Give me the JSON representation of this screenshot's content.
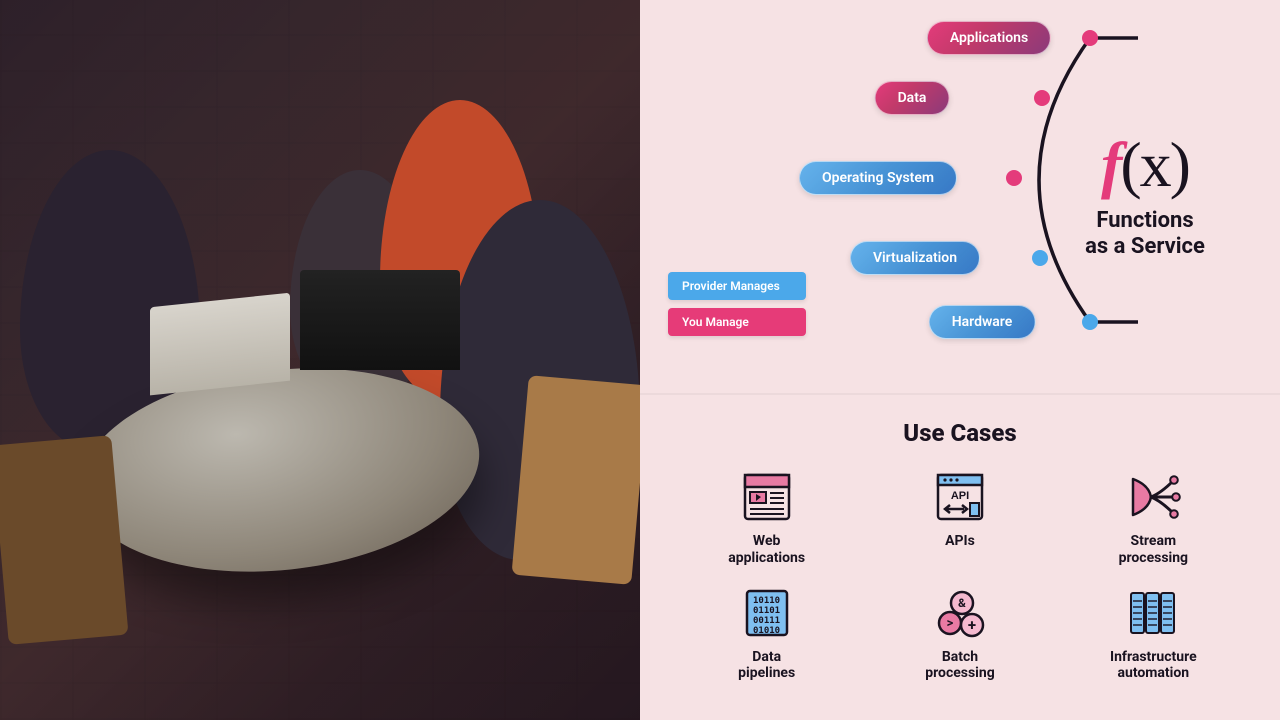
{
  "colors": {
    "pink": "#e43b7b",
    "blue": "#4ba8ea",
    "bg": "#f6e2e4",
    "text": "#1a1320"
  },
  "diagram": {
    "faas_symbol_f": "f",
    "faas_symbol_x": "(x)",
    "faas_caption": "Functions\nas a Service",
    "layers": [
      {
        "label": "Applications",
        "managed_by": "you",
        "pill": "pink",
        "dot": "pink"
      },
      {
        "label": "Data",
        "managed_by": "provider",
        "pill": "pink",
        "dot": "pink"
      },
      {
        "label": "Operating System",
        "managed_by": "provider",
        "pill": "blue",
        "dot": "pink"
      },
      {
        "label": "Virtualization",
        "managed_by": "provider",
        "pill": "blue",
        "dot": "blue"
      },
      {
        "label": "Hardware",
        "managed_by": "provider",
        "pill": "blue",
        "dot": "blue"
      }
    ],
    "legend": {
      "provider": "Provider Manages",
      "you": "You Manage"
    }
  },
  "usecases": {
    "title": "Use Cases",
    "items": [
      {
        "label": "Web\napplications",
        "icon": "web-app-icon"
      },
      {
        "label": "APIs",
        "icon": "api-icon"
      },
      {
        "label": "Stream\nprocessing",
        "icon": "stream-icon"
      },
      {
        "label": "Data\npipelines",
        "icon": "data-pipelines-icon"
      },
      {
        "label": "Batch\nprocessing",
        "icon": "batch-icon"
      },
      {
        "label": "Infrastructure\nautomation",
        "icon": "infra-icon"
      }
    ]
  }
}
